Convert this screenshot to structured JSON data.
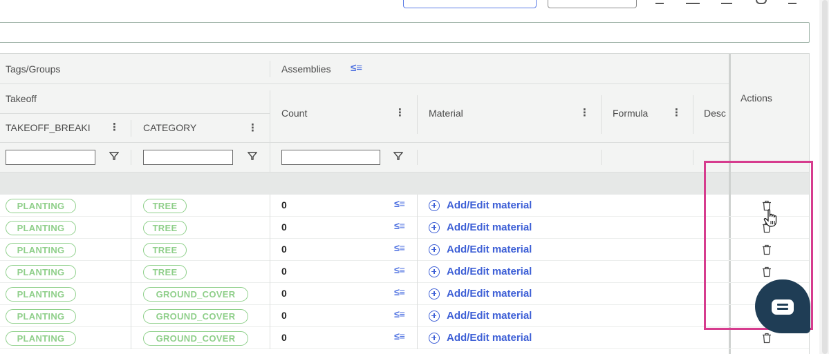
{
  "columns": {
    "tags_groups": "Tags/Groups",
    "assemblies": "Assemblies",
    "takeoff": "Takeoff",
    "takeoff_breakdown": "TAKEOFF_BREAKI",
    "category": "CATEGORY",
    "count": "Count",
    "material": "Material",
    "formula": "Formula",
    "description": "Desc",
    "actions": "Actions"
  },
  "rows": [
    {
      "takeoff": "PLANTING",
      "category": "TREE",
      "count": "0",
      "material": "Add/Edit material"
    },
    {
      "takeoff": "PLANTING",
      "category": "TREE",
      "count": "0",
      "material": "Add/Edit material"
    },
    {
      "takeoff": "PLANTING",
      "category": "TREE",
      "count": "0",
      "material": "Add/Edit material"
    },
    {
      "takeoff": "PLANTING",
      "category": "TREE",
      "count": "0",
      "material": "Add/Edit material"
    },
    {
      "takeoff": "PLANTING",
      "category": "GROUND_COVER",
      "count": "0",
      "material": "Add/Edit material"
    },
    {
      "takeoff": "PLANTING",
      "category": "GROUND_COVER",
      "count": "0",
      "material": "Add/Edit material"
    },
    {
      "takeoff": "PLANTING",
      "category": "GROUND_COVER",
      "count": "0",
      "material": "Add/Edit material"
    }
  ],
  "colors": {
    "accent_blue": "#3d5fd6",
    "tag_green": "#8fcf8a",
    "highlight_pink": "#d63c8e",
    "chat_navy": "#1f3d55"
  },
  "icons": {
    "assembly": "assembly-list-icon",
    "filter": "filter-icon",
    "delete": "trash-icon",
    "add": "plus-circle-icon",
    "chat": "chat-bubble-icon"
  }
}
